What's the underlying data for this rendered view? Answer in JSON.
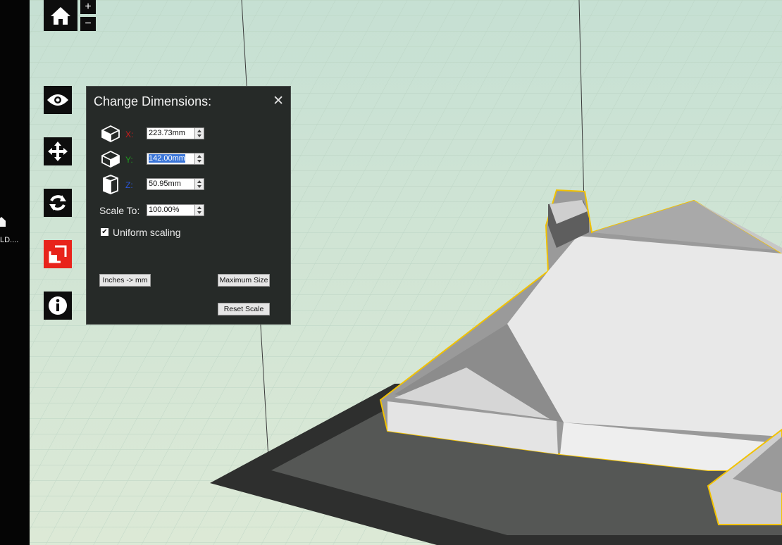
{
  "toolbar": {
    "home_icon": "home-icon",
    "zoom_in_label": "+",
    "zoom_out_label": "−",
    "tools": [
      {
        "name": "eye-icon",
        "active": false
      },
      {
        "name": "move-icon",
        "active": false
      },
      {
        "name": "rotate-icon",
        "active": false
      },
      {
        "name": "scale-icon",
        "active": true
      },
      {
        "name": "info-icon",
        "active": false
      }
    ],
    "accent": "#e8231b"
  },
  "desktop": {
    "label": "LD...."
  },
  "panel": {
    "title": "Change Dimensions:",
    "close_label": "✕",
    "x_label": "X:",
    "x_value": "223.73mm",
    "y_label": "Y:",
    "y_value": "142.00mm",
    "z_label": "Z:",
    "z_value": "50.95mm",
    "x_color": "#cc1c1c",
    "y_color": "#1f9a1f",
    "z_color": "#2a56d8",
    "scale_label": "Scale To:",
    "scale_value": "100.00%",
    "uniform_label": "Uniform scaling",
    "uniform_checked": true,
    "inches_button": "Inches -> mm",
    "max_button": "Maximum Size",
    "reset_button": "Reset Scale"
  },
  "viewport": {
    "outline_color": "#f2c200",
    "grid_color": "#c8dccd",
    "bed_color": "#2f302f"
  }
}
